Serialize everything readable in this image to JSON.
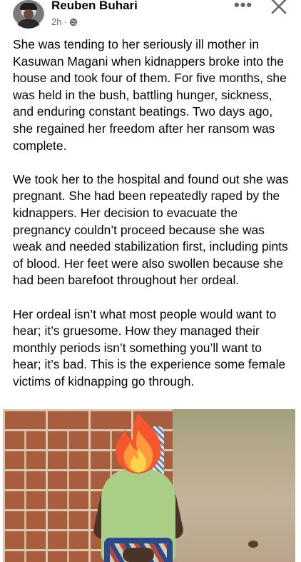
{
  "post": {
    "author": "Reuben Buhari",
    "time": "2h",
    "privacy_icon": "globe-icon",
    "more_icon": "ellipsis-icon",
    "close_icon": "close-icon",
    "paragraphs": [
      "She was tending to her seriously ill mother in Kasuwan Magani when kidnappers broke into the house and took four of them. For five months, she was held in the bush, battling hunger, sickness, and enduring constant beatings. Two days ago, she regained her freedom after her ransom was complete.",
      "We took her to the hospital and found out she was pregnant. She had been repeatedly raped by the kidnappers. Her decision to evacuate the pregnancy couldn’t proceed because she was weak and needed stabilization first, including pints of blood. Her feet were also swollen because she had been barefoot throughout her ordeal.",
      "Her ordeal isn’t what most people would want to hear; it’s gruesome. How they managed their monthly periods isn’t something you’ll want to hear; it’s bad. This is the experience some female victims of kidnapping go through."
    ],
    "photo_overlay_icon": "fire-emoji-icon"
  },
  "colors": {
    "text": "#050505",
    "secondary": "#65676b",
    "background": "#ffffff"
  }
}
